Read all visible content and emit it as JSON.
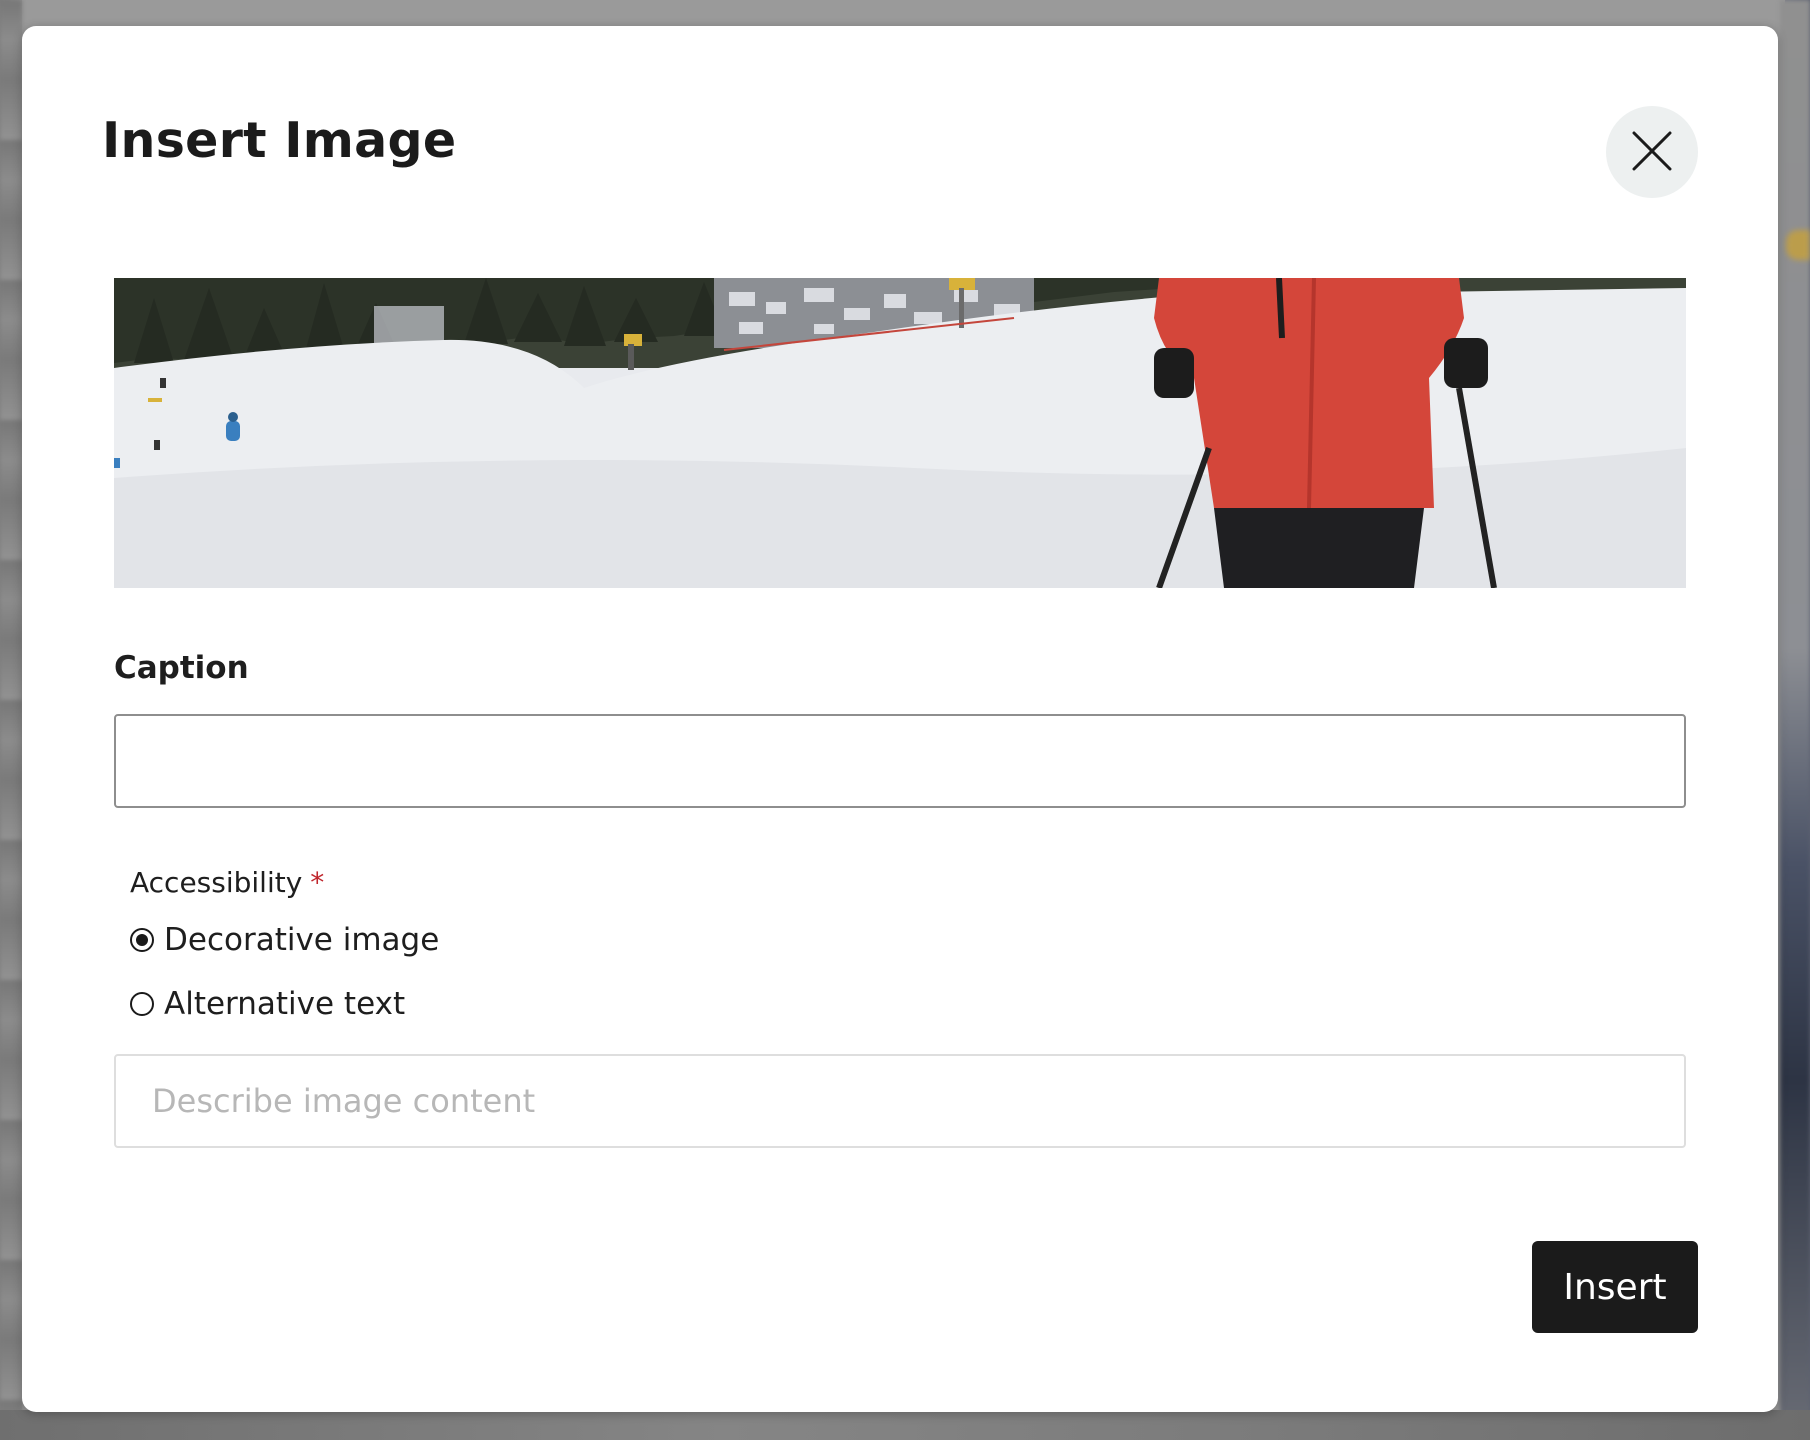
{
  "dialog": {
    "title": "Insert Image",
    "close_icon": "close-icon",
    "image_alt": "Skier in red jacket on snowy slope"
  },
  "caption": {
    "label": "Caption",
    "value": "",
    "placeholder": ""
  },
  "accessibility": {
    "label": "Accessibility",
    "required_mark": "*",
    "options": [
      {
        "label": "Decorative image",
        "selected": true
      },
      {
        "label": "Alternative text",
        "selected": false
      }
    ],
    "alt_text_placeholder": "Describe image content",
    "alt_text_value": ""
  },
  "actions": {
    "insert_label": "Insert"
  },
  "colors": {
    "primary_button": "#1b1b1b",
    "required": "#c0262d",
    "jacket": "#d4463a"
  }
}
